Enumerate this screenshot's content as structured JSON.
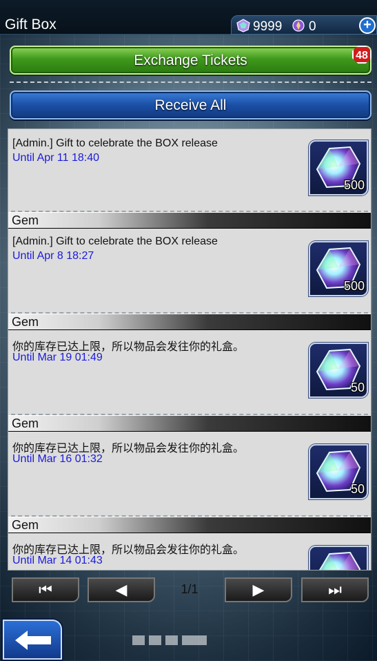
{
  "header": {
    "title": "Gift Box",
    "gems": "9999",
    "tickets": "0",
    "plus_icon": "plus-circle-icon"
  },
  "actions": {
    "exchange_label": "Exchange Tickets",
    "exchange_badge": "48",
    "receive_all_label": "Receive All"
  },
  "gifts": [
    {
      "category": "",
      "title": "[Admin.] Gift to celebrate the BOX release",
      "until": "Until Apr 11 18:40",
      "quantity": "500",
      "icon": "gem-icon"
    },
    {
      "category": "Gem",
      "title": "[Admin.] Gift to celebrate the BOX release",
      "until": "Until Apr 8 18:27",
      "quantity": "500",
      "icon": "gem-icon"
    },
    {
      "category": "Gem",
      "title": "你的库存已达上限，所以物品会发往你的礼盒。",
      "until": "Until Mar 19 01:49",
      "quantity": "50",
      "icon": "gem-icon"
    },
    {
      "category": "Gem",
      "title": "你的库存已达上限，所以物品会发往你的礼盒。",
      "until": "Until Mar 16 01:32",
      "quantity": "50",
      "icon": "gem-icon"
    },
    {
      "category": "Gem",
      "title": "你的库存已达上限，所以物品会发往你的礼盒。",
      "until": "Until Mar 14 01:43",
      "quantity": "",
      "icon": "gem-icon"
    }
  ],
  "pager": {
    "first": "⏮",
    "prev": "◀",
    "page": "1/1",
    "next": "▶",
    "last": "⏭"
  },
  "colors": {
    "date_text": "#1a1adc",
    "exchange_green": "#3f9a1c",
    "receive_blue": "#1b4fa6",
    "badge_red": "#d21c1c"
  }
}
